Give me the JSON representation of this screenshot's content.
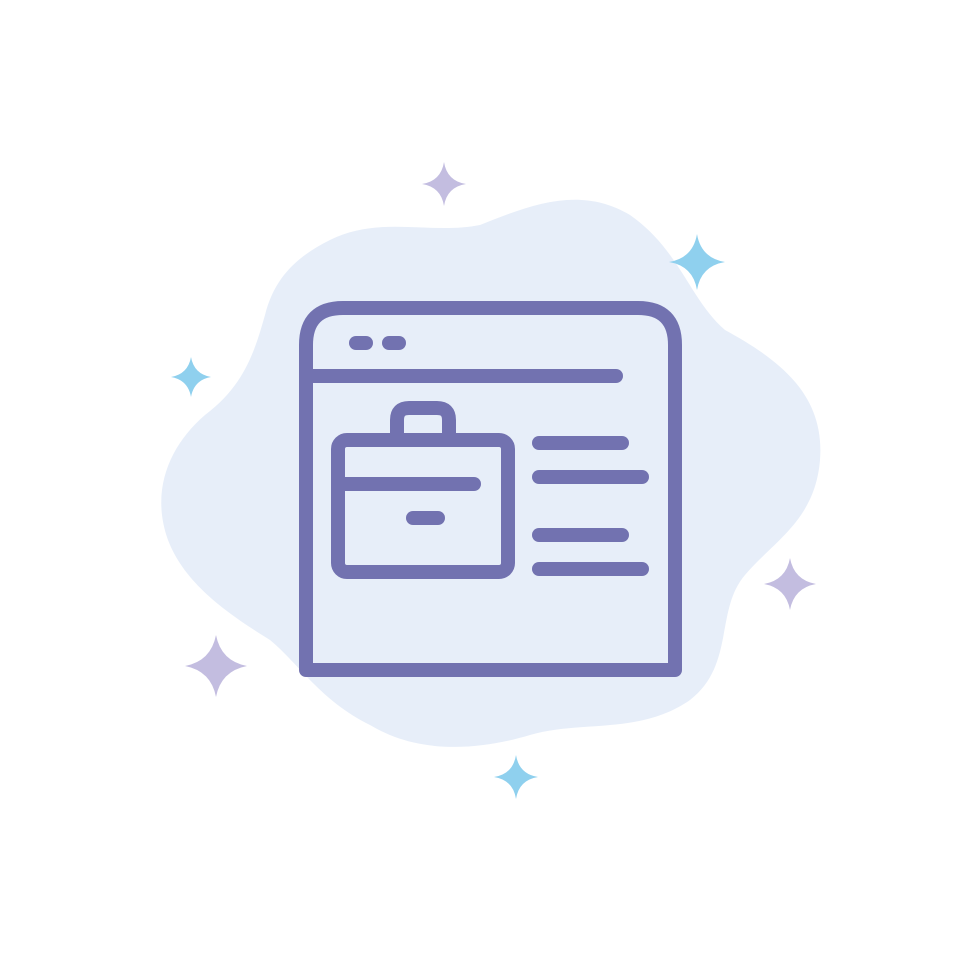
{
  "illustration": {
    "icon": "browser-window-briefcase-icon",
    "background_shape": "cloud-blob",
    "decorations": "sparkle-stars"
  },
  "colors": {
    "page_background": "#ffffff",
    "cloud_fill": "#e7eef9",
    "outline_stroke": "#7272b0",
    "star_blue": "#8fd0ee",
    "star_lilac": "#c3bde0"
  }
}
